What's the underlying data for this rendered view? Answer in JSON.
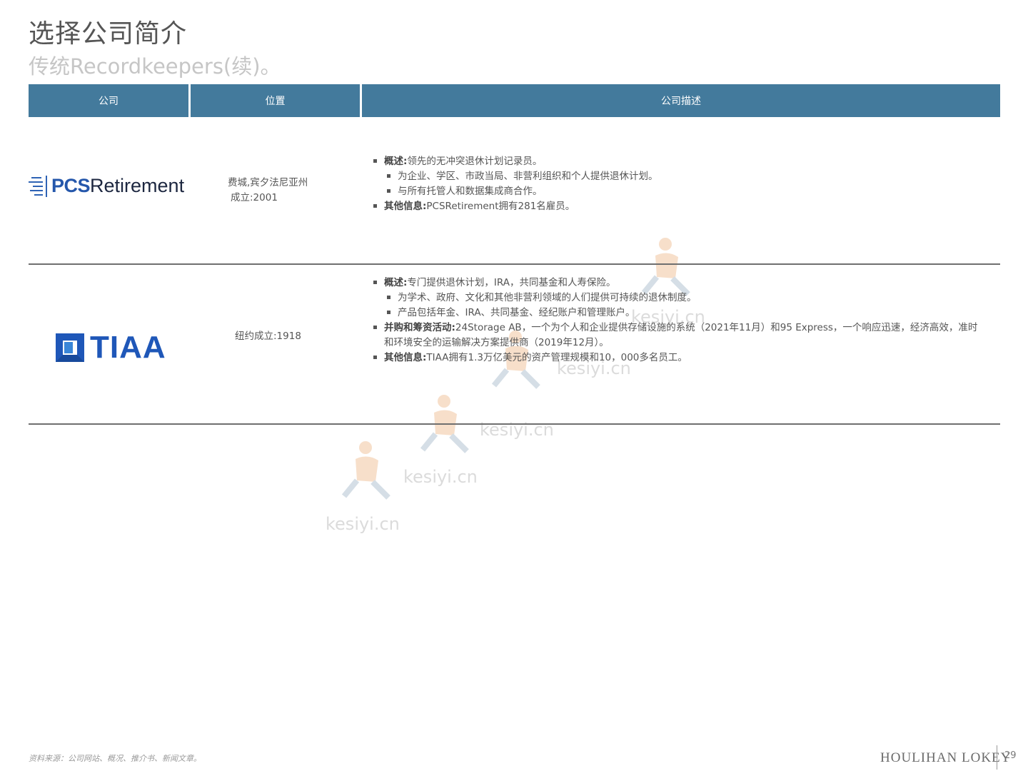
{
  "title": "选择公司简介",
  "subtitle": "传统Recordkeepers(续)。",
  "table": {
    "headers": [
      "公司",
      "位置",
      "公司描述"
    ]
  },
  "rows": [
    {
      "logo_text_bold": "PCS",
      "logo_text": "Retirement",
      "location_lines": [
        "费城,宾夕法尼亚州",
        "成立:2001"
      ],
      "desc": {
        "b1_label": "概述:",
        "b1_text": "领先的无冲突退休计划记录员。",
        "b1_sub1": "为企业、学区、市政当局、非营利组织和个人提供退休计划。",
        "b1_sub2": "与所有托管人和数据集成商合作。",
        "b2_label": "其他信息:",
        "b2_text": "PCSRetirement拥有281名雇员。"
      }
    },
    {
      "logo_text": "TIAA",
      "location_lines": [
        "纽约成立:1918"
      ],
      "desc": {
        "b1_label": "概述:",
        "b1_text": "专门提供退休计划，IRA，共同基金和人寿保险。",
        "b1_sub1": "为学术、政府、文化和其他非营利领域的人们提供可持续的退休制度。",
        "b1_sub2": "产品包括年金、IRA、共同基金、经纪账户和管理账户。",
        "b2_label": "并购和筹资活动:",
        "b2_text": "24Storage AB，一个为个人和企业提供存储设施的系统（2021年11月）和95 Express，一个响应迅速，经济高效，准时和环境安全的运输解决方案提供商（2019年12月）。",
        "b3_label": "其他信息:",
        "b3_text": "TIAA拥有1.3万亿美元的资产管理规模和10，000多名员工。"
      }
    }
  ],
  "watermarks": [
    "kesiyi.cn",
    "kesiyi.cn",
    "kesiyi.cn",
    "kesiyi.cn",
    "kesiyi.cn"
  ],
  "footer": {
    "source": "资料来源：公司网站、概况、推介书、新闻文章。",
    "brand": "HOULIHAN LOKEY",
    "page": "29"
  }
}
